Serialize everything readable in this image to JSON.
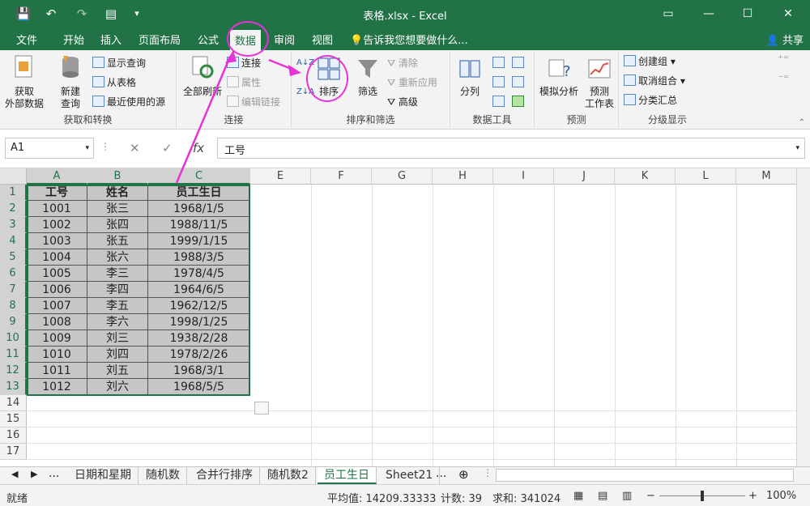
{
  "window": {
    "title": "表格.xlsx - Excel",
    "controls": {
      "ribbon_opts": "▭",
      "minimize": "—",
      "maximize": "☐",
      "close": "✕"
    }
  },
  "qat": {
    "save_icon": "save-icon",
    "undo_icon": "undo-icon",
    "redo_icon": "redo-icon",
    "form_icon": "form-icon",
    "more_icon": "more-icon"
  },
  "tabs": [
    {
      "label": "文件"
    },
    {
      "label": "开始"
    },
    {
      "label": "插入"
    },
    {
      "label": "页面布局"
    },
    {
      "label": "公式"
    },
    {
      "label": "数据",
      "active": true
    },
    {
      "label": "审阅"
    },
    {
      "label": "视图"
    }
  ],
  "tell_me": "告诉我您想要做什么...",
  "share": "共享",
  "ribbon": {
    "get_transform": {
      "label": "获取和转换",
      "get_external_1": "获取",
      "get_external_2": "外部数据",
      "new_query_1": "新建",
      "new_query_2": "查询",
      "show_queries": "显示查询",
      "from_table": "从表格",
      "recent_sources": "最近使用的源"
    },
    "connections": {
      "label": "连接",
      "refresh_all": "全部刷新",
      "connections": "连接",
      "properties": "属性",
      "edit_links": "编辑链接"
    },
    "sort_filter": {
      "label": "排序和筛选",
      "sort": "排序",
      "filter": "筛选",
      "clear": "清除",
      "reapply": "重新应用",
      "advanced": "高级"
    },
    "data_tools": {
      "label": "数据工具",
      "text_to_columns": "分列"
    },
    "forecast": {
      "label": "预测",
      "what_if": "模拟分析",
      "forecast_sheet_1": "预测",
      "forecast_sheet_2": "工作表"
    },
    "outline": {
      "label": "分级显示",
      "group": "创建组",
      "ungroup": "取消组合",
      "subtotal": "分类汇总"
    }
  },
  "formula_bar": {
    "name_box": "A1",
    "fx": "fx",
    "cancel": "✕",
    "enter": "✓",
    "value": "工号"
  },
  "columns": [
    "A",
    "B",
    "C",
    "E",
    "F",
    "G",
    "H",
    "I",
    "J",
    "K",
    "L",
    "M"
  ],
  "rows": [
    "1",
    "2",
    "3",
    "4",
    "5",
    "6",
    "7",
    "8",
    "9",
    "10",
    "11",
    "12",
    "13",
    "14",
    "15",
    "16",
    "17"
  ],
  "table": {
    "headers": [
      "工号",
      "姓名",
      "员工生日"
    ],
    "rows": [
      [
        "1001",
        "张三",
        "1968/1/5"
      ],
      [
        "1002",
        "张四",
        "1988/11/5"
      ],
      [
        "1003",
        "张五",
        "1999/1/15"
      ],
      [
        "1004",
        "张六",
        "1988/3/5"
      ],
      [
        "1005",
        "李三",
        "1978/4/5"
      ],
      [
        "1006",
        "李四",
        "1964/6/5"
      ],
      [
        "1007",
        "李五",
        "1962/12/5"
      ],
      [
        "1008",
        "李六",
        "1998/1/25"
      ],
      [
        "1009",
        "刘三",
        "1938/2/28"
      ],
      [
        "1010",
        "刘四",
        "1978/2/26"
      ],
      [
        "1011",
        "刘五",
        "1968/3/1"
      ],
      [
        "1012",
        "刘六",
        "1968/5/5"
      ]
    ]
  },
  "sheets": {
    "ellipsis": "...",
    "tabs": [
      "日期和星期",
      "随机数",
      "合并行排序",
      "随机数2",
      "员工生日",
      "Sheet21"
    ],
    "active": "员工生日"
  },
  "status": {
    "ready": "就绪",
    "average": "平均值: 14209.33333",
    "count": "计数: 39",
    "sum": "求和: 341024",
    "zoom": "100%"
  },
  "colors": {
    "excel_green": "#217346",
    "annotation": "#e632d9"
  }
}
